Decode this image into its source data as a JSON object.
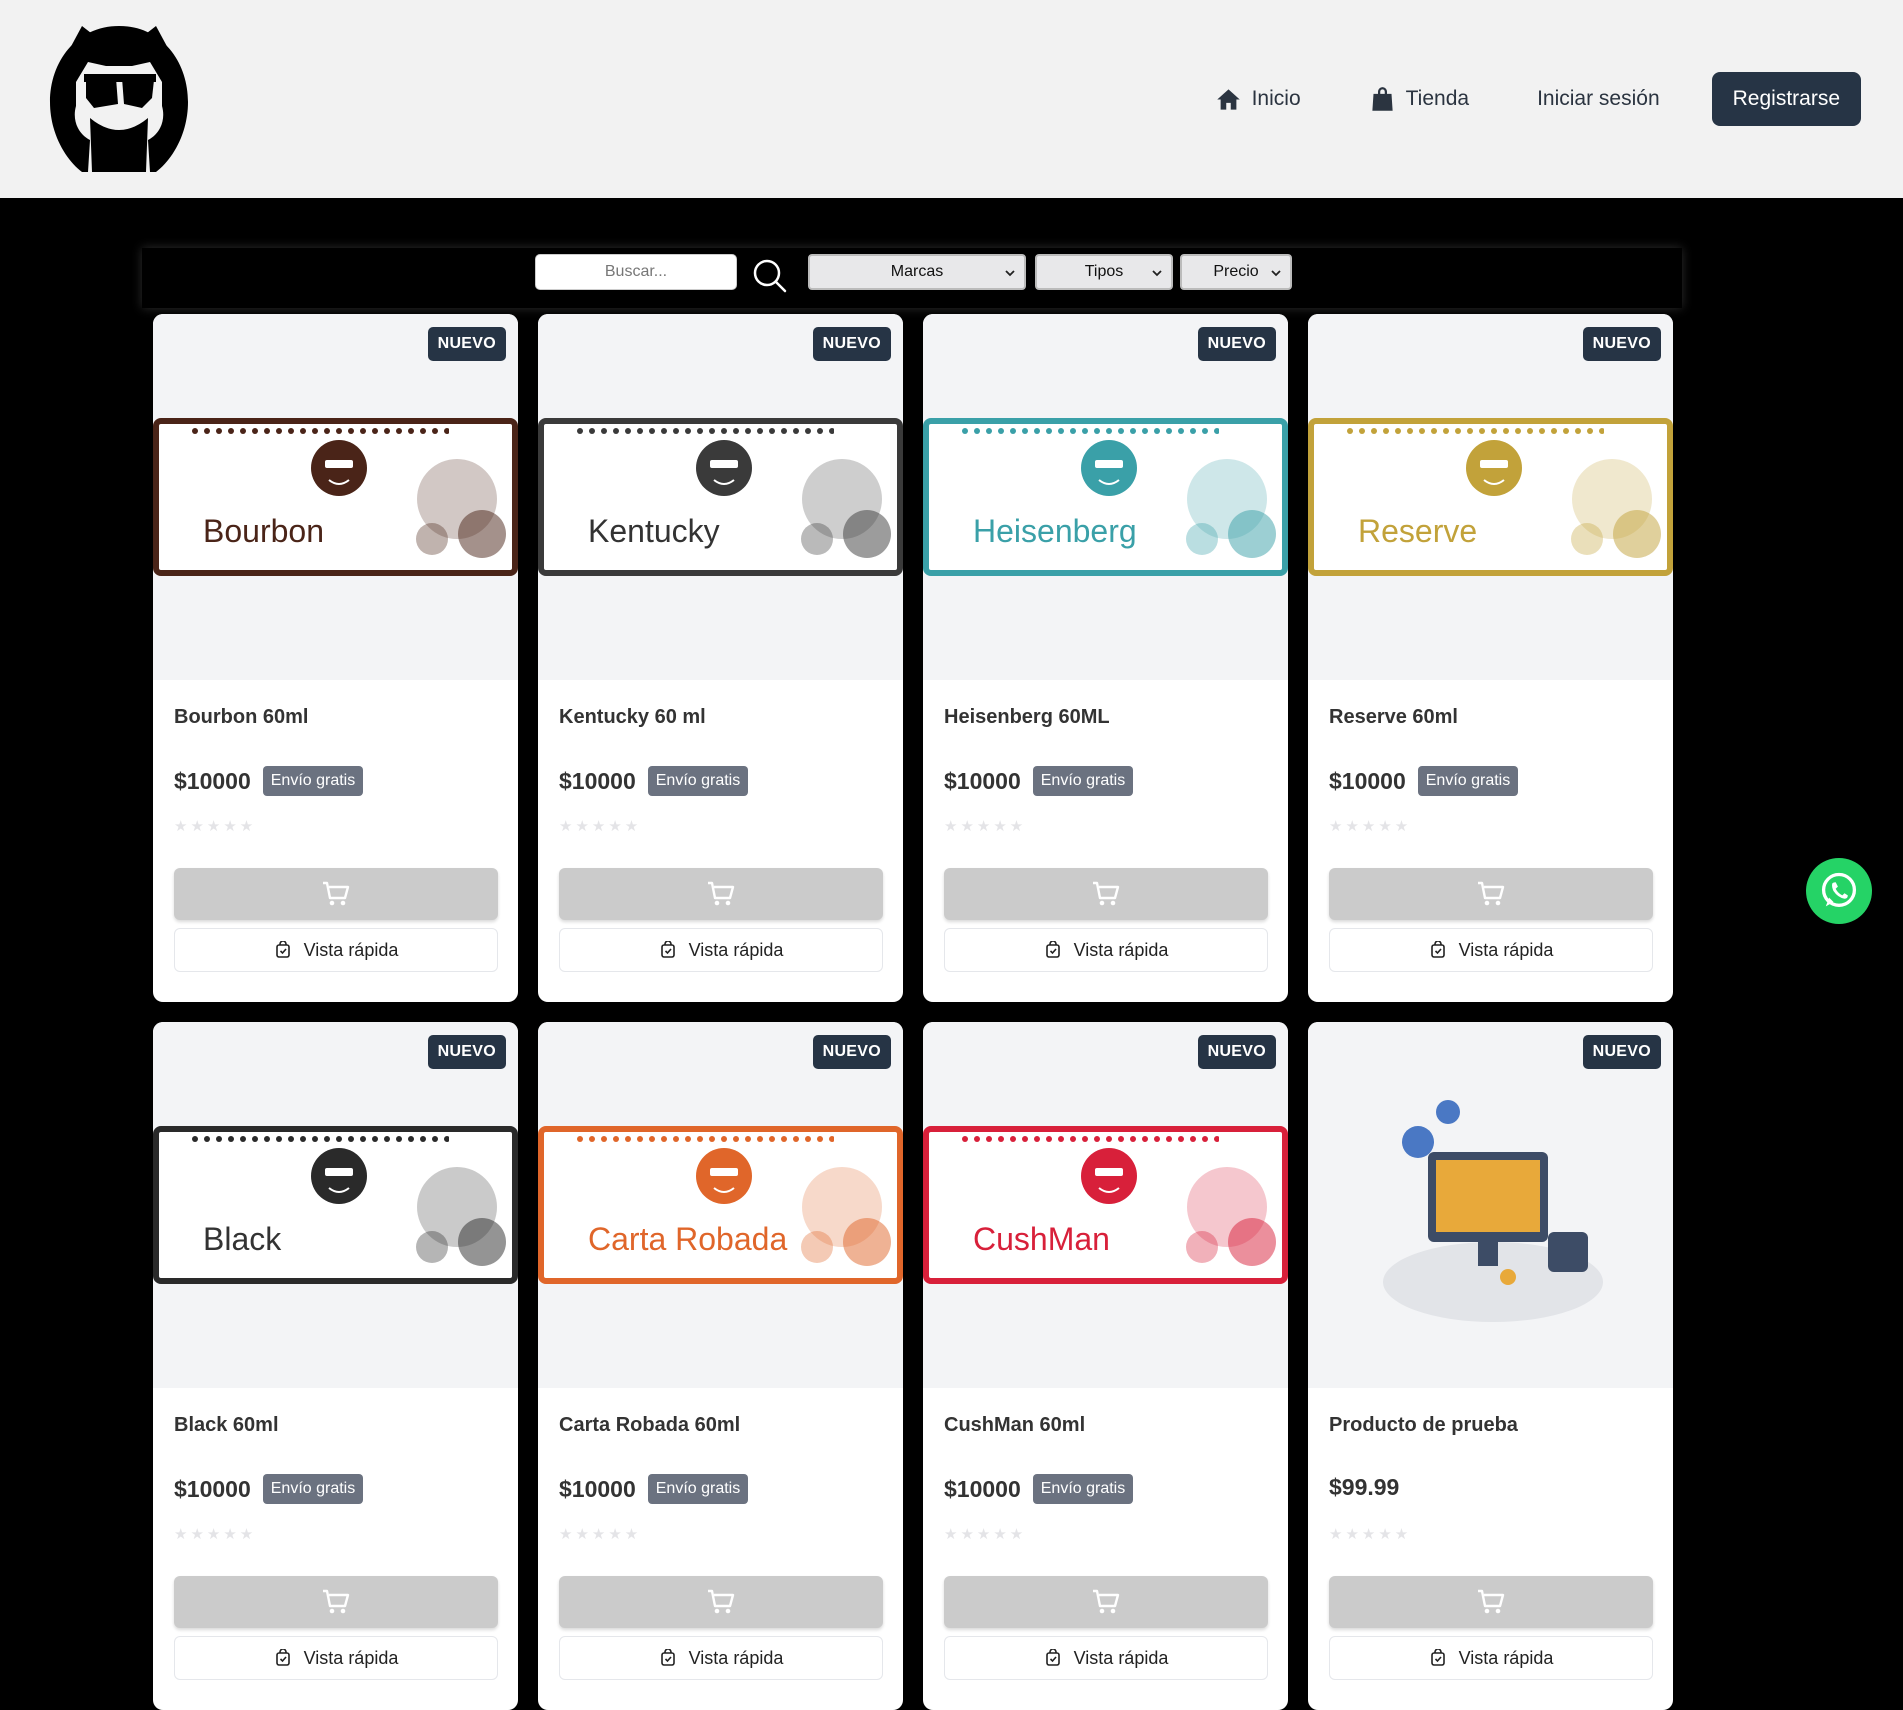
{
  "header": {
    "logo_icon": "cat-with-sunglasses-logo",
    "nav": [
      {
        "label": "Inicio",
        "icon": "home-icon"
      },
      {
        "label": "Tienda",
        "icon": "shopping-bag-icon"
      },
      {
        "label": "Iniciar sesión"
      }
    ],
    "register_label": "Registrarse"
  },
  "filters": {
    "search_placeholder": "Buscar...",
    "brands_label": "Marcas",
    "types_label": "Tipos",
    "price_label": "Precio"
  },
  "colors": {
    "header_bg": "#f2f2f2",
    "page_bg": "#000000",
    "accent": "#263445",
    "badge": "#263445",
    "ship_badge": "#6b7280",
    "cart_button": "#cbcbcb",
    "whatsapp": "#25d366"
  },
  "products": [
    {
      "name": "Bourbon 60ml",
      "price": "$10000",
      "shipping": "Envío gratis",
      "badge": "NUEVO",
      "banner_text": "Bourbon",
      "banner_color": "#4a2418",
      "rating": 0,
      "image": "bourbon-banner"
    },
    {
      "name": "Kentucky 60 ml",
      "price": "$10000",
      "shipping": "Envío gratis",
      "badge": "NUEVO",
      "banner_text": "Kentucky",
      "banner_color": "#3a3a3a",
      "rating": 0,
      "image": "kentucky-banner"
    },
    {
      "name": "Heisenberg 60ML",
      "price": "$10000",
      "shipping": "Envío gratis",
      "badge": "NUEVO",
      "banner_text": "Heisenberg",
      "banner_color": "#3aa0a8",
      "rating": 0,
      "image": "heisenberg-banner"
    },
    {
      "name": "Reserve 60ml",
      "price": "$10000",
      "shipping": "Envío gratis",
      "badge": "NUEVO",
      "banner_text": "Reserve",
      "banner_color": "#c2a23a",
      "rating": 0,
      "image": "reserve-banner"
    },
    {
      "name": "Black 60ml",
      "price": "$10000",
      "shipping": "Envío gratis",
      "badge": "NUEVO",
      "banner_text": "Black",
      "banner_color": "#2a2a2a",
      "rating": 0,
      "image": "black-banner"
    },
    {
      "name": "Carta Robada 60ml",
      "price": "$10000",
      "shipping": "Envío gratis",
      "badge": "NUEVO",
      "banner_text": "Carta Robada",
      "banner_color": "#e0662a",
      "rating": 0,
      "image": "carta-robada-banner"
    },
    {
      "name": "CushMan 60ml",
      "price": "$10000",
      "shipping": "Envío gratis",
      "badge": "NUEVO",
      "banner_text": "CushMan",
      "banner_color": "#d8203a",
      "rating": 0,
      "image": "cushman-banner"
    },
    {
      "name": "Producto de prueba",
      "price": "$99.99",
      "shipping": "",
      "badge": "NUEVO",
      "banner_text": "",
      "banner_color": "",
      "rating": 0,
      "image": "settings-illustration"
    }
  ],
  "quick_view_label": "Vista rápida",
  "stars": "★★★★★",
  "whatsapp_icon": "whatsapp-icon"
}
